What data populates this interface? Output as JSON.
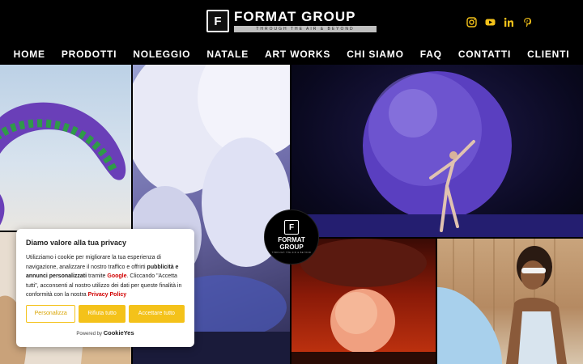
{
  "header": {
    "logo_name": "FORMAT GROUP",
    "logo_tagline": "THROUGH THE AIR & BEYOND",
    "logo_letter": "F"
  },
  "socials": {
    "instagram_color": "#f4c21a",
    "youtube_color": "#f4c21a",
    "linkedin_color": "#f4c21a",
    "pinterest_color": "#f4c21a"
  },
  "nav": {
    "items": [
      "HOME",
      "PRODOTTI",
      "NOLEGGIO",
      "NATALE",
      "ART WORKS",
      "CHI SIAMO",
      "FAQ",
      "CONTATTI",
      "CLIENTI"
    ]
  },
  "badge": {
    "letter": "F",
    "name_line1": "FORMAT",
    "name_line2": "GROUP",
    "tagline": "THROUGH THE AIR & BEYOND"
  },
  "cookie": {
    "title": "Diamo valore alla tua privacy",
    "text_1": "Utilizziamo i cookie per migliorare la tua esperienza di navigazione, analizzare il nostro traffico e offrirti ",
    "bold_1": "pubblicità e annunci personalizzati",
    "text_2": " tramite ",
    "link_google": "Google",
    "text_3": ". Cliccando \"Accetta tutti\", acconsenti al nostro utilizzo dei dati per queste finalità in conformità con la nostra ",
    "link_privacy": "Privacy Policy",
    "btn_customize": "Personalizza",
    "btn_reject": "Rifiuta tutto",
    "btn_accept": "Accettare tutto",
    "powered_by": "Powered by",
    "brand": "CookieYes"
  },
  "colors": {
    "accent": "#f4c21a",
    "link": "#d10000"
  }
}
